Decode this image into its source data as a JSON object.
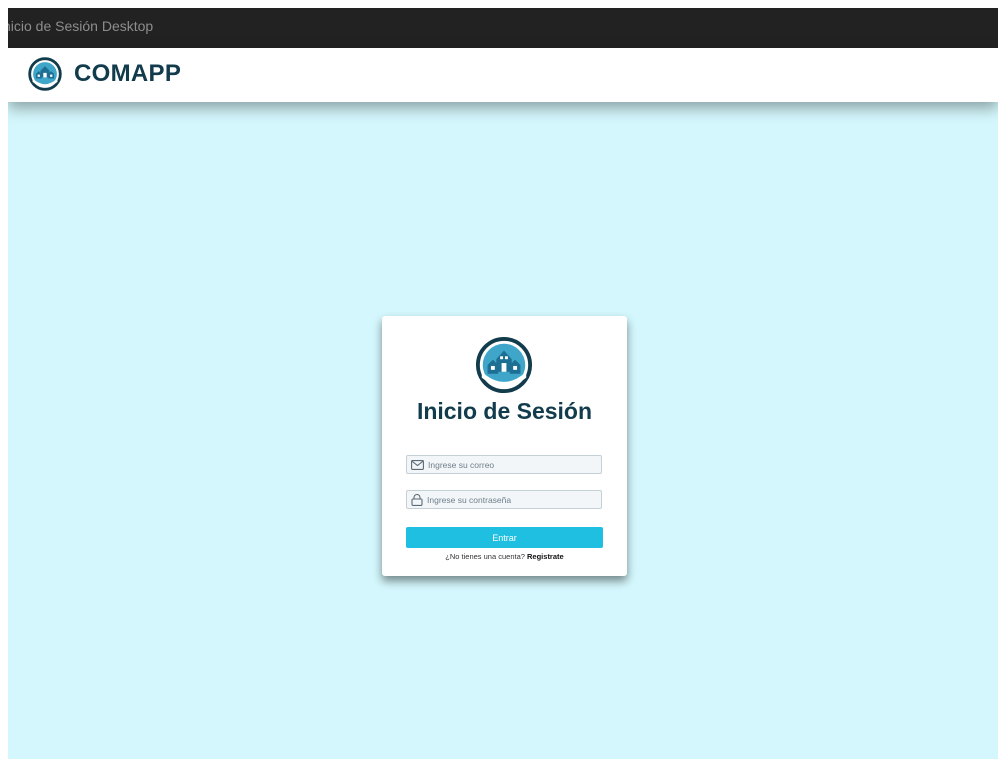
{
  "window": {
    "title": "nicio de Sesión Desktop"
  },
  "header": {
    "brand": "COMAPP",
    "logo_icon": "house-community-logo-icon"
  },
  "login": {
    "title": "Inicio de Sesión",
    "email_placeholder": "Ingrese su correo",
    "password_placeholder": "Ingrese su contraseña",
    "submit_label": "Entrar",
    "register_prompt": "¿No tienes una cuenta?",
    "register_link": "Registrate"
  },
  "colors": {
    "background": "#d3f7fc",
    "brand_text": "#123b4c",
    "button": "#1ebfe0",
    "titlebar": "#222222"
  }
}
